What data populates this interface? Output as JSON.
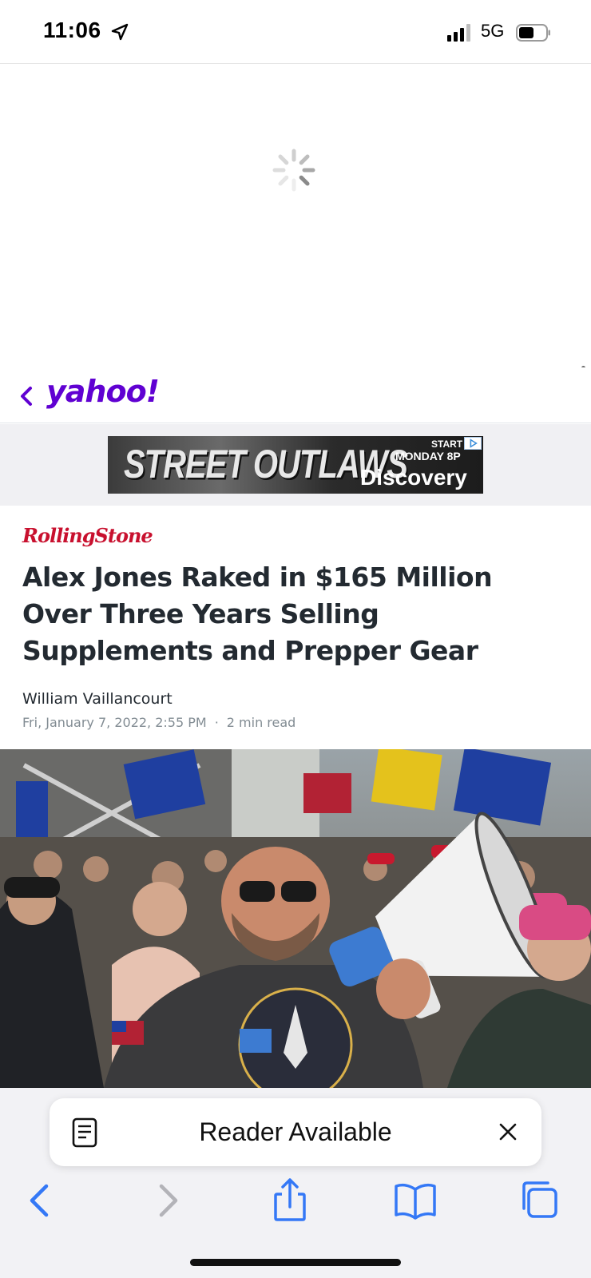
{
  "status_bar": {
    "time": "11:06",
    "network": "5G"
  },
  "browser_header": {
    "brand": "yahoo!"
  },
  "ad": {
    "title": "STREET OUTLAWS",
    "start": "START",
    "day": "MONDAY 8P",
    "brand": "Discovery"
  },
  "article": {
    "source": "RollingStone",
    "headline": "Alex Jones Raked in $165 Million Over Three Years Selling Supplements and Prepper Gear",
    "author": "William Vaillancourt",
    "date": "Fri, January 7, 2022, 2:55 PM",
    "separator": "·",
    "read_time": "2 min read"
  },
  "reader_banner": {
    "label": "Reader Available"
  },
  "toolbar": {
    "icons": [
      "back-icon",
      "forward-icon",
      "share-icon",
      "bookmarks-icon",
      "tabs-icon"
    ]
  },
  "colors": {
    "yahoo_purple": "#6001d2",
    "ios_blue": "#3478f6",
    "rolling_red": "#c8102e"
  }
}
